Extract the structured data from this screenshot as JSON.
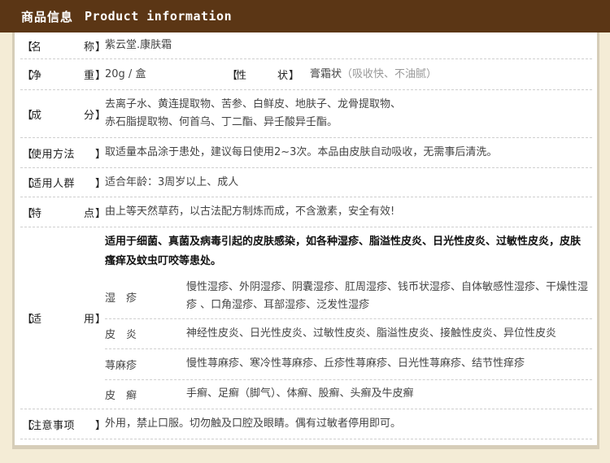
{
  "header": {
    "title_cn": "商品信息",
    "title_en": "Product information"
  },
  "rows": {
    "name": {
      "label_parts": [
        "名",
        "称"
      ],
      "value": "紫云堂.康肤霜"
    },
    "weight": {
      "label_parts": [
        "净",
        "重"
      ],
      "value": "20g / 盒"
    },
    "form": {
      "label_parts": [
        "性",
        "状"
      ],
      "value": "膏霜状",
      "note": "（吸收快、不油腻）"
    },
    "ingredients": {
      "label_parts": [
        "成",
        "分"
      ],
      "line1": "去离子水、黄连提取物、苦参、白鲜皮、地肤子、龙骨提取物、",
      "line2": "赤石脂提取物、何首乌、丁二酯、异壬酸异壬酯。"
    },
    "usage": {
      "label": "使用方法",
      "value": "取适量本品涂于患处，建议每日使用2~3次。本品由皮肤自动吸收，无需事后清洗。"
    },
    "audience": {
      "label": "适用人群",
      "value": "适合年龄：3周岁以上、成人"
    },
    "features": {
      "label_parts": [
        "特",
        "点"
      ],
      "value": "由上等天然草药，以古法配方制炼而成，不含激素，安全有效!"
    },
    "applicable": {
      "label_parts": [
        "适",
        "用"
      ],
      "headline": "适用于细菌、真菌及病毒引起的皮肤感染，如各种湿疹、脂溢性皮炎、日光性皮炎、过敏性皮炎，皮肤瘙痒及蚊虫叮咬等患处。",
      "items": [
        {
          "name": "湿　疹",
          "desc": "慢性湿疹、外阴湿疹、阴囊湿疹、肛周湿疹、钱币状湿疹、自体敏感性湿疹、干燥性湿疹 、口角湿疹、耳部湿疹、泛发性湿疹"
        },
        {
          "name": "皮　炎",
          "desc": "神经性皮炎、日光性皮炎、过敏性皮炎、脂溢性皮炎、接触性皮炎、异位性皮炎"
        },
        {
          "name": "荨麻疹",
          "desc": "慢性荨麻疹、寒冷性荨麻疹、丘疹性荨麻疹、日光性荨麻疹、结节性痒疹"
        },
        {
          "name": "皮　癣",
          "desc": "手癣、足癣（脚气）、体癣、股癣、头癣及牛皮癣"
        }
      ]
    },
    "caution": {
      "label": "注意事项",
      "value": "外用，禁止口服。切勿触及口腔及眼睛。偶有过敏者停用即可。"
    }
  },
  "bracket_open": "【",
  "bracket_close": "】"
}
